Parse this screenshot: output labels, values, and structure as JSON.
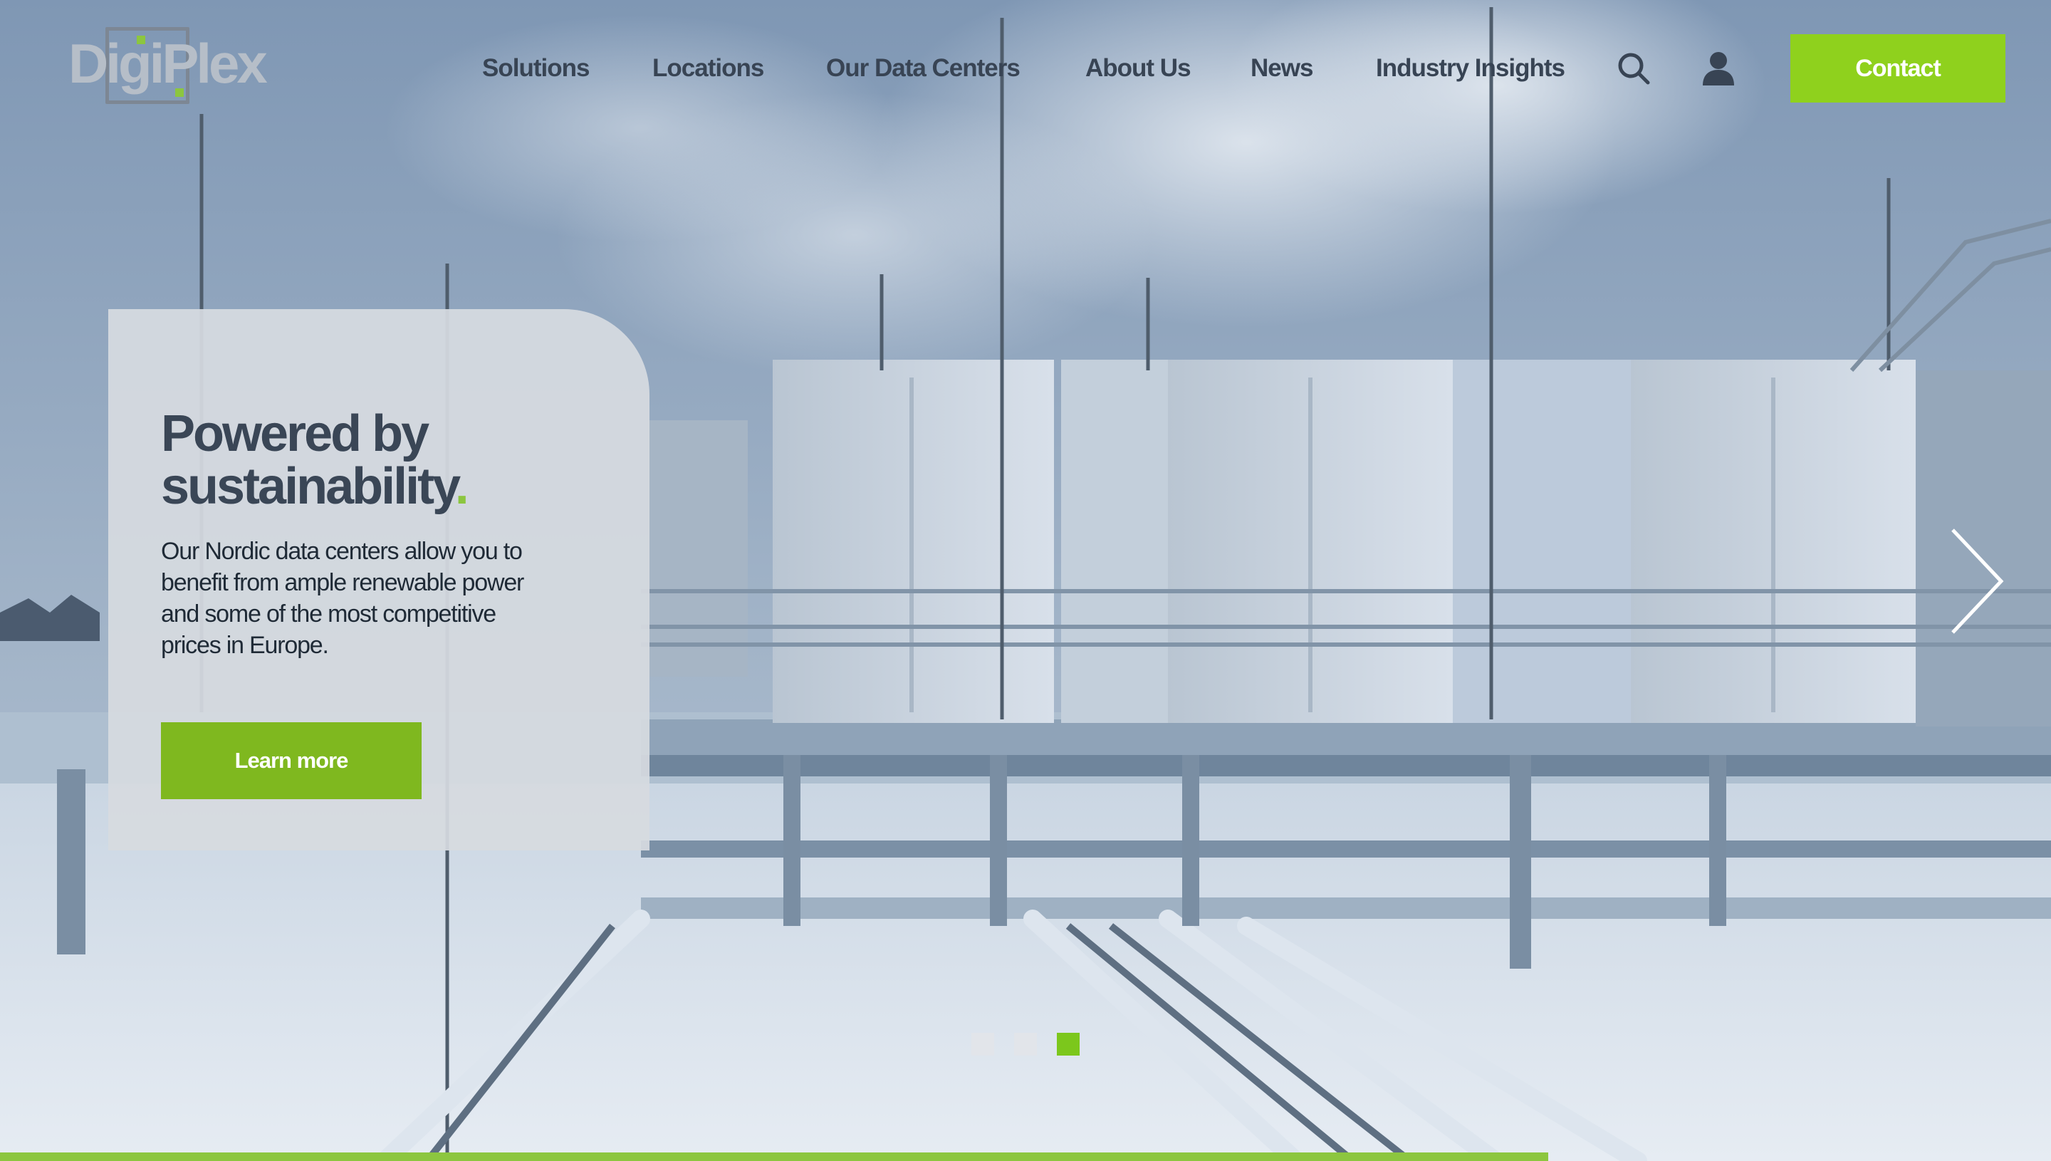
{
  "brand": {
    "logo_text": "DigiPlex",
    "accent_color": "#8cc63f"
  },
  "nav": {
    "items": [
      {
        "label": "Solutions"
      },
      {
        "label": "Locations"
      },
      {
        "label": "Our Data Centers"
      },
      {
        "label": "About Us"
      },
      {
        "label": "News"
      },
      {
        "label": "Industry Insights"
      }
    ],
    "search_icon": "search-icon",
    "account_icon": "user-icon",
    "contact_label": "Contact"
  },
  "hero": {
    "title_line1": "Powered by",
    "title_line2": "sustainability",
    "title_accent": ".",
    "body": "Our Nordic data centers allow you to benefit from ample renewable power and some of the most competitive prices in Europe.",
    "cta_label": "Learn more",
    "next_icon": "chevron-right-icon",
    "slides_total": 3,
    "active_slide": 3,
    "progress_fraction": 0.755
  }
}
